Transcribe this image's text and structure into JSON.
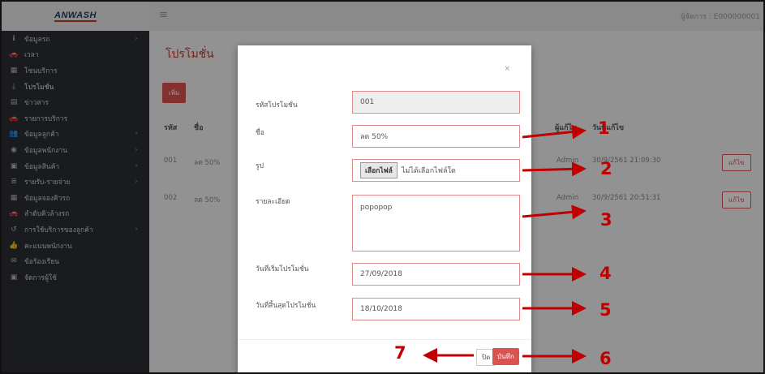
{
  "brand": {
    "logo_text": "ANWASH"
  },
  "topbar": {
    "user_label": "ผู้จัดการ : E000000001"
  },
  "sidebar": {
    "items": [
      {
        "label": "ข้อมูลรถ",
        "icon": "info-icon",
        "chevron": true
      },
      {
        "label": "เวลา",
        "icon": "car-icon"
      },
      {
        "label": "โซนบริการ",
        "icon": "grid-icon"
      },
      {
        "label": "โปรโมชั่น",
        "icon": "download-icon",
        "active": true
      },
      {
        "label": "ข่าวสาร",
        "icon": "news-icon"
      },
      {
        "label": "รายการบริการ",
        "icon": "car-icon"
      },
      {
        "label": "ข้อมูลลูกค้า",
        "icon": "users-icon",
        "chevron": true
      },
      {
        "label": "ข้อมูลพนักงาน",
        "icon": "user-circle-icon",
        "chevron": true
      },
      {
        "label": "ข้อมูลสินค้า",
        "icon": "box-icon",
        "chevron": true
      },
      {
        "label": "รายรับ-รายจ่าย",
        "icon": "list-icon",
        "chevron": true
      },
      {
        "label": "ข้อมูลจองคิวรถ",
        "icon": "calendar-icon"
      },
      {
        "label": "ลำดับคิวล้างรถ",
        "icon": "car-icon"
      },
      {
        "label": "การใช้บริการของลูกค้า",
        "icon": "history-icon",
        "chevron": true
      },
      {
        "label": "คะแนนพนักงาน",
        "icon": "thumbs-up-icon"
      },
      {
        "label": "ข้อร้องเรียน",
        "icon": "complaint-icon"
      },
      {
        "label": "จัดการผู้ใช้",
        "icon": "user-admin-icon"
      }
    ]
  },
  "page": {
    "title": "โปรโมชั่น",
    "add_label": "เพิ่ม",
    "table": {
      "headers": [
        "รหัส",
        "ชื่อ",
        "ผู้แก้ไข",
        "วันที่แก้ไข"
      ],
      "rows": [
        {
          "code": "001",
          "name": "ลด 50%",
          "editor": "Admin",
          "date": "30/9/2561 21:09:30",
          "edit": "แก้ไข"
        },
        {
          "code": "002",
          "name": "ลด 50%",
          "editor": "Admin",
          "date": "30/9/2561 20:51:31",
          "edit": "แก้ไข"
        }
      ]
    }
  },
  "modal": {
    "close_symbol": "×",
    "fields": {
      "code": {
        "label": "รหัสโปรโมชั่น",
        "value": "001"
      },
      "name": {
        "label": "ชื่อ",
        "value": "ลด 50%"
      },
      "image": {
        "label": "รูป",
        "button": "เลือกไฟล์",
        "status": "ไม่ได้เลือกไฟล์ใด"
      },
      "detail": {
        "label": "รายละเอียด",
        "value": "popopop"
      },
      "start": {
        "label": "วันที่เริ่มโปรโมชั่น",
        "value": "27/09/2018"
      },
      "end": {
        "label": "วันที่สิ้นสุดโปรโมชั่น",
        "value": "18/10/2018"
      }
    },
    "close_label": "ปิด",
    "save_label": "บันทึก"
  },
  "annotations": [
    "1",
    "2",
    "3",
    "4",
    "5",
    "6",
    "7"
  ],
  "colors": {
    "accent": "#d9534f",
    "arrow": "#c00000",
    "sidebar": "#2a2d33"
  }
}
